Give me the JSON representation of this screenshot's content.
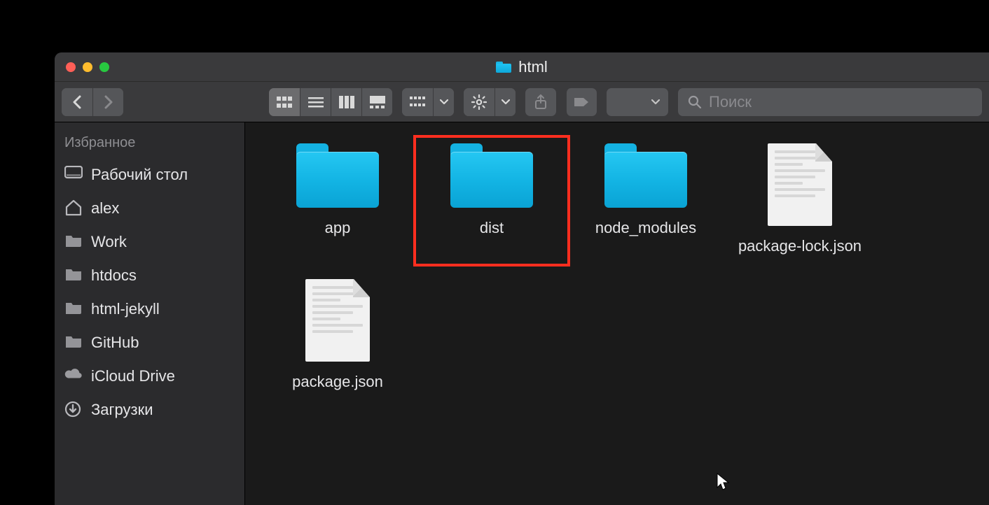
{
  "window": {
    "title": "html"
  },
  "search": {
    "placeholder": "Поиск",
    "value": ""
  },
  "sidebar": {
    "header": "Избранное",
    "items": [
      {
        "label": "Рабочий стол",
        "icon": "desktop"
      },
      {
        "label": "alex",
        "icon": "home"
      },
      {
        "label": "Work",
        "icon": "folder"
      },
      {
        "label": "htdocs",
        "icon": "folder"
      },
      {
        "label": "html-jekyll",
        "icon": "folder"
      },
      {
        "label": "GitHub",
        "icon": "folder"
      },
      {
        "label": "iCloud Drive",
        "icon": "cloud"
      },
      {
        "label": "Загрузки",
        "icon": "download"
      }
    ]
  },
  "content": {
    "items": [
      {
        "name": "app",
        "type": "folder",
        "highlight": false
      },
      {
        "name": "dist",
        "type": "folder",
        "highlight": true
      },
      {
        "name": "node_modules",
        "type": "folder",
        "highlight": false
      },
      {
        "name": "package-lock.json",
        "type": "file",
        "highlight": false
      },
      {
        "name": "package.json",
        "type": "file",
        "highlight": false
      }
    ]
  }
}
